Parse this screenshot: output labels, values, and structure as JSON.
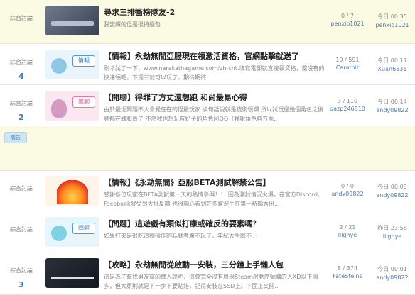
{
  "rows": [
    {
      "category": "綜合討論",
      "reply_count": "",
      "title": "尋求三排衝榜隊友-2",
      "desc": "我蠻鐵的但是很持續包",
      "thumb_style": "game",
      "tag": "",
      "stats": "0 / 7",
      "author": "penxio1021",
      "time": "今日 00:35",
      "last_user": "penxio1021",
      "highlight": true
    },
    {
      "category": "綜合討論",
      "reply_count": "4",
      "title": "【情報】永劫無間亞服現在領激活資格，官網點擊就送了",
      "desc": "剛才試了一下，www.narakathegame.com/zh-cht.填寫電郵就直接領資格，還沒有的快速領吧，下週三就可以玩了，期待期待",
      "thumb_style": "info",
      "tag": "情報",
      "stats": "10 / 591",
      "author": "Carathir",
      "time": "今日 00:17",
      "last_user": "Xuan6531",
      "highlight": false
    },
    {
      "category": "綜合討論",
      "reply_count": "2",
      "title": "【開聊】得罪了方丈還想跑 和尚最易心得",
      "desc": "由於最近問題不大會覺在在的怪最玩家 換句話說就是技術很爛 所以試玩過幾個角色之後就都在練和尚了 不然我也想玩有奶子的角色阿QQ（我說角色各方面..",
      "thumb_style": "chat",
      "tag": "閒聊",
      "stats": "3 / 110",
      "author": "qazp246810",
      "time": "今日 00:14",
      "last_user": "andy09822",
      "highlight": false
    },
    {
      "category": "綜合討論",
      "reply_count": "",
      "title": "【情報】《永劫無間》亞服BETA測試解禁公告】",
      "desc": "感謝各位玩家在BETA測試第一天的熱情參與！！ 因為測試情況火爆。在官方Discord、Facebook發受到大批反饋 也很開心看到許多實況主在第一時間秀出...",
      "thumb_style": "fire",
      "tag": "",
      "stats": "0 / 0",
      "author": "andy09822",
      "time": "今日 00:09",
      "last_user": "andy09822",
      "highlight": false
    },
    {
      "category": "綜合討論",
      "reply_count": "",
      "title": "【問題】這遊戲有類似打康或確反的要素嗎？",
      "desc": "如果打架是很吃這種操作的話就考慮不玩了，年紀大手跟不上",
      "thumb_style": "question",
      "tag": "問題",
      "stats": "2 / 21",
      "author": "lllghye",
      "time": "昨日 23:58",
      "last_user": "lllghye",
      "highlight": false
    },
    {
      "category": "綜合討論",
      "reply_count": "3",
      "title": "【攻略】永劫無間從啟動一安裝，三分鐘上手懶人包",
      "desc": "這是為了幫找男友寫的懶人說明，這會完全沒有用過Steam啟動序號購的人XD以下圖多，但大原則就是下一步下要點錯，記得安裝在SSD上。下面正文開..",
      "thumb_style": "guide",
      "tag": "",
      "stats": "8 / 374",
      "author": "FateSteins",
      "time": "今日 00:01",
      "last_user": "andy09822",
      "highlight": false
    }
  ],
  "separator_button": "廣告",
  "accent_color": "#4a7cb3",
  "highlight_color": "#fbfae3"
}
